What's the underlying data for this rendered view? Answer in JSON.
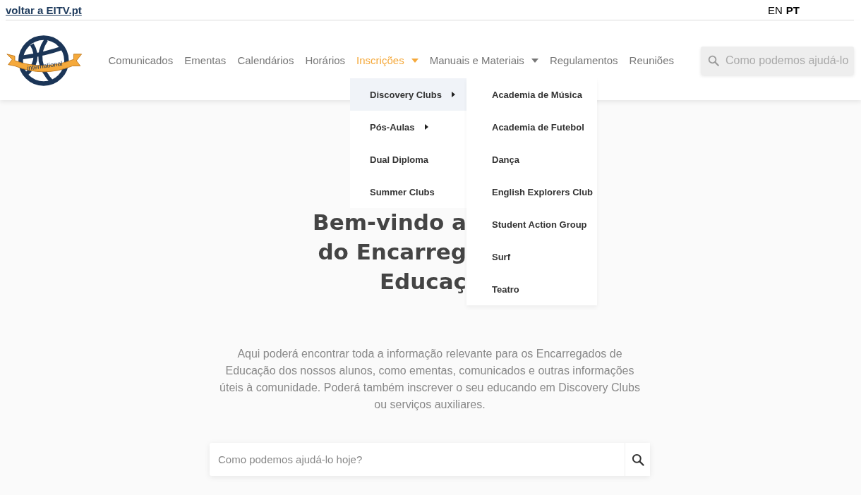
{
  "top_bar": {
    "link": "voltar a EITV.pt",
    "languages": [
      {
        "label": "EN",
        "selected": false
      },
      {
        "label": "PT",
        "selected": true
      }
    ]
  },
  "header": {
    "logo": {
      "text": "international"
    },
    "nav": [
      {
        "label": "Comunicados",
        "selected": false,
        "has_dropdown": false
      },
      {
        "label": "Ementas",
        "selected": false,
        "has_dropdown": false
      },
      {
        "label": "Calendários",
        "selected": false,
        "has_dropdown": false
      },
      {
        "label": "Horários",
        "selected": false,
        "has_dropdown": false
      },
      {
        "label": "Inscrições",
        "selected": true,
        "has_dropdown": true
      },
      {
        "label": "Manuais e Materiais",
        "selected": false,
        "has_dropdown": true
      },
      {
        "label": "Regulamentos",
        "selected": false,
        "has_dropdown": false
      },
      {
        "label": "Reuniões",
        "selected": false,
        "has_dropdown": false
      }
    ],
    "search": {
      "placeholder": "Como podemos ajudá-lo"
    }
  },
  "dropdown": {
    "items": [
      {
        "label": "Discovery Clubs",
        "has_submenu": true,
        "selected": true
      },
      {
        "label": "Pós-Aulas",
        "has_submenu": true,
        "selected": false
      },
      {
        "label": "Dual Diploma",
        "has_submenu": false,
        "selected": false
      },
      {
        "label": "Summer Clubs",
        "has_submenu": false,
        "selected": false
      }
    ],
    "submenu": [
      "Academia de Música",
      "Academia de Futebol",
      "Dança",
      "English Explorers Club",
      "Student Action Group",
      "Surf",
      "Teatro"
    ]
  },
  "hero": {
    "heading_lines": [
      "Bem-vindo a",
      "do Encarreg",
      "Educaç"
    ],
    "intro": "Aqui poderá encontrar toda a informação relevante para os Encarregados de Educação dos nossos alunos, como ementas, comunicados e outras informações úteis à comunidade. Poderá também inscrever o seu educando em Discovery Clubs ou serviços auxiliares.",
    "search": {
      "placeholder": "Como podemos ajudá-lo hoje?"
    }
  }
}
